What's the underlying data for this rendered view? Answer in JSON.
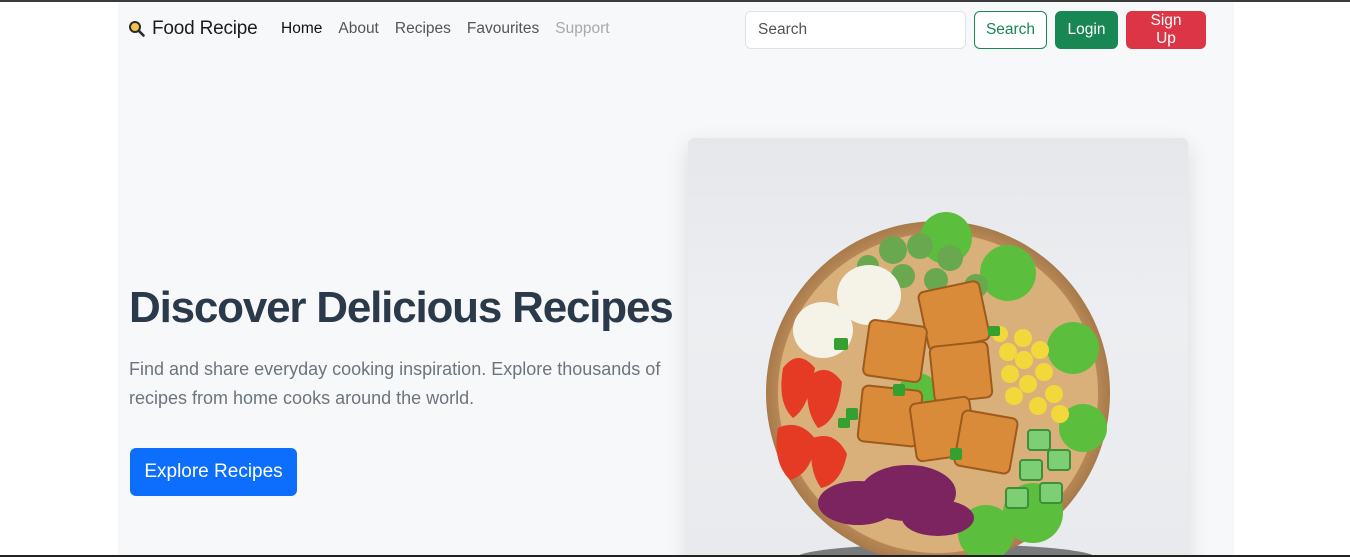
{
  "navbar": {
    "brand": {
      "icon": "magnifier-icon",
      "label": "Food Recipe"
    },
    "links": [
      {
        "label": "Home",
        "state": "active"
      },
      {
        "label": "About",
        "state": "normal"
      },
      {
        "label": "Recipes",
        "state": "normal"
      },
      {
        "label": "Favourites",
        "state": "normal"
      },
      {
        "label": "Support",
        "state": "disabled"
      }
    ],
    "search": {
      "placeholder": "Search",
      "value": "",
      "button_label": "Search"
    },
    "login_label": "Login",
    "signup_label": "Sign Up"
  },
  "hero": {
    "title": "Discover Delicious Recipes",
    "subtitle": "Find and share everyday cooking inspiration. Explore thousands of recipes from home cooks around the world.",
    "cta_label": "Explore Recipes",
    "image": "salad-bowl-photo"
  },
  "colors": {
    "primary": "#0d6efd",
    "success": "#198754",
    "danger": "#dc3545",
    "heading": "#2b3a4a",
    "muted": "#6c757d",
    "page_bg": "#f7f8fa"
  }
}
